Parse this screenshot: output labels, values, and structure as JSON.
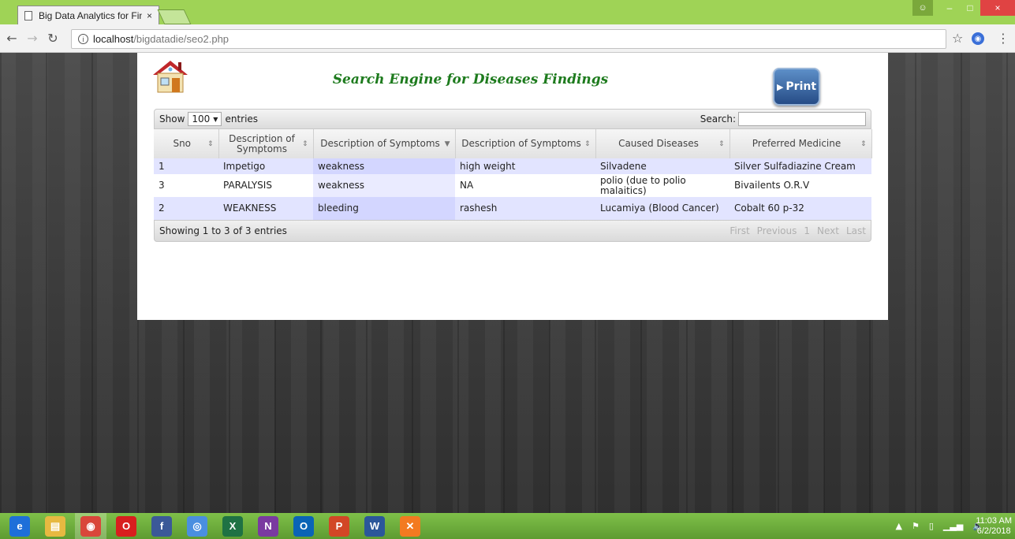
{
  "browser": {
    "tab_title": "Big Data Analytics for Fin",
    "tab_close": "×",
    "url_host": "localhost",
    "url_path": "/bigdatadie/seo2.php",
    "win_min": "–",
    "win_max": "□",
    "win_close": "×"
  },
  "page": {
    "title": "Search Engine for Diseases Findings",
    "print_label": "Print"
  },
  "table": {
    "show_label": "Show",
    "length_value": "100",
    "entries_label": "entries",
    "search_label": "Search:",
    "search_value": "",
    "columns": [
      "Sno",
      "Description of Symptoms",
      "Description of Symptoms",
      "Description of Symptoms",
      "Caused Diseases",
      "Preferred Medicine"
    ],
    "rows": [
      [
        "1",
        "Impetigo",
        "weakness",
        "high weight",
        "Silvadene",
        "Silver Sulfadiazine Cream"
      ],
      [
        "3",
        "PARALYSIS",
        "weakness",
        "NA",
        "polio (due to polio malaitics)",
        "Bivailents O.R.V"
      ],
      [
        "2",
        "WEAKNESS",
        "bleeding",
        "rashesh",
        "Lucamiya (Blood Cancer)",
        "Cobalt 60 p-32"
      ]
    ],
    "info": "Showing 1 to 3 of 3 entries",
    "pager": [
      "First",
      "Previous",
      "1",
      "Next",
      "Last"
    ]
  },
  "taskbar": {
    "time": "11:03 AM",
    "date": "6/2/2018",
    "apps": [
      {
        "name": "internet-explorer",
        "glyph": "e",
        "color": "#1e6fd9"
      },
      {
        "name": "file-explorer",
        "glyph": "▤",
        "color": "#e7b941"
      },
      {
        "name": "chrome",
        "glyph": "◉",
        "color": "#d9473a"
      },
      {
        "name": "opera",
        "glyph": "O",
        "color": "#d81e1e"
      },
      {
        "name": "facebook",
        "glyph": "f",
        "color": "#3b5998"
      },
      {
        "name": "chromium",
        "glyph": "◎",
        "color": "#4a8fe0"
      },
      {
        "name": "excel",
        "glyph": "X",
        "color": "#1f7244"
      },
      {
        "name": "onenote",
        "glyph": "N",
        "color": "#7a3aa0"
      },
      {
        "name": "outlook",
        "glyph": "O",
        "color": "#0a64b6"
      },
      {
        "name": "powerpoint",
        "glyph": "P",
        "color": "#d24726"
      },
      {
        "name": "word",
        "glyph": "W",
        "color": "#2b579a"
      },
      {
        "name": "xampp",
        "glyph": "✕",
        "color": "#f37a20"
      }
    ]
  }
}
